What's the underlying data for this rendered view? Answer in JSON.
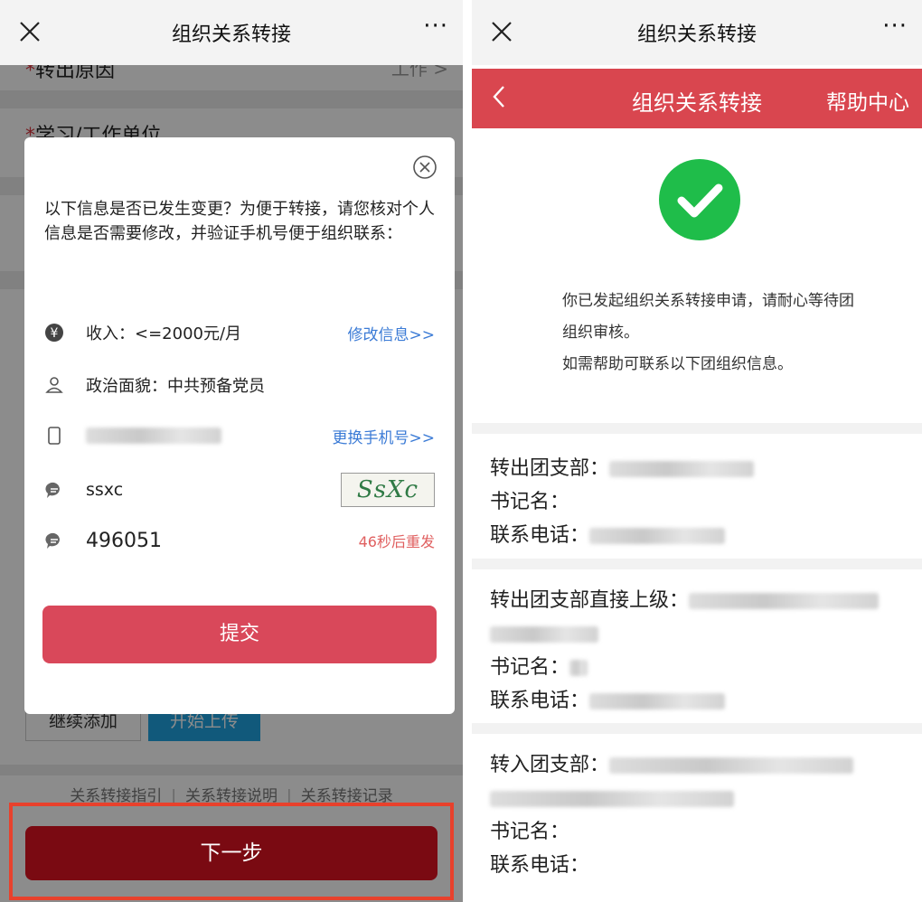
{
  "left": {
    "window_title": "组织关系转接",
    "more": "···",
    "form": {
      "row1_label": "转出原因",
      "row1_value": "工作  >",
      "row2_label": "学习/工作单位",
      "continue_add": "继续添加",
      "start_upload": "开始上传",
      "links": [
        "关系转接指引",
        "关系转接说明",
        "关系转接记录"
      ],
      "next": "下一步"
    },
    "modal": {
      "message": "以下信息是否已发生变更？为便于转接，请您核对个人信息是否需要修改，并验证手机号便于组织联系：",
      "income": "收入：<=2000元/月",
      "edit_info": "修改信息>>",
      "political": "政治面貌：中共预备党员",
      "change_phone": "更换手机号>>",
      "captcha_input": "ssxc",
      "captcha_image": "SsXc",
      "sms_code": "496051",
      "resend": "46秒后重发",
      "submit": "提交"
    }
  },
  "right": {
    "window_title": "组织关系转接",
    "more": "···",
    "header_title": "组织关系转接",
    "help": "帮助中心",
    "status_lines": [
      "你已发起组织关系转接申请，请耐心等待团",
      "组织审核。",
      "如需帮助可联系以下团组织信息。"
    ],
    "sections": [
      {
        "label1": "转出团支部：",
        "label2": "书记名：",
        "label3": "联系电话："
      },
      {
        "label1": "转出团支部直接上级：",
        "label2": "书记名：",
        "label3": "联系电话："
      },
      {
        "label1": "转入团支部：",
        "label2": "书记名：",
        "label3": "联系电话："
      }
    ]
  },
  "colors": {
    "brand_red": "#d9464f",
    "next_dark_red": "#7a0a12",
    "success_green": "#1fbd4a",
    "link_blue": "#3b7bd6"
  }
}
